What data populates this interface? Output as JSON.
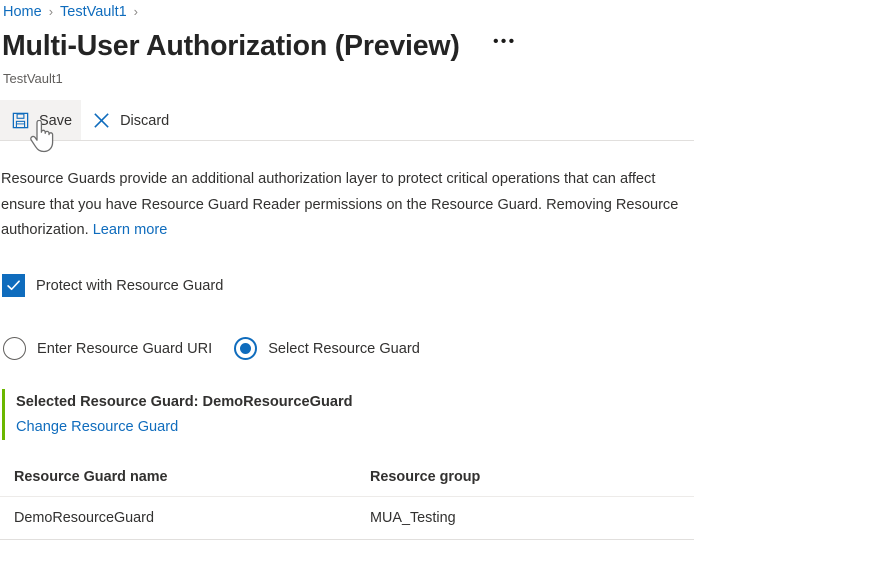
{
  "breadcrumb": {
    "items": [
      {
        "label": "Home"
      },
      {
        "label": "TestVault1"
      }
    ],
    "separator": "›"
  },
  "header": {
    "title": "Multi-User Authorization (Preview)",
    "subtitle": "TestVault1",
    "more_menu_label": "•••"
  },
  "toolbar": {
    "save_label": "Save",
    "save_icon": "save-floppy-icon",
    "discard_label": "Discard",
    "discard_icon": "close-x-icon",
    "hovered_button": "save"
  },
  "description": {
    "line1": "Resource Guards provide an additional authorization layer to protect critical operations that can affect",
    "line2": "ensure that you have Resource Guard Reader permissions on the Resource Guard. Removing Resource",
    "line3_prefix": "authorization.",
    "learn_more_label": "Learn more"
  },
  "protect_checkbox": {
    "label": "Protect with Resource Guard",
    "checked": true
  },
  "mode_radios": {
    "options": [
      {
        "label": "Enter Resource Guard URI",
        "selected": false
      },
      {
        "label": "Select Resource Guard",
        "selected": true
      }
    ]
  },
  "selected_guard": {
    "summary": "Selected Resource Guard: DemoResourceGuard",
    "change_link_label": "Change Resource Guard",
    "accent_color": "#6bb700"
  },
  "guard_table": {
    "columns": [
      "Resource Guard name",
      "Resource group"
    ],
    "rows": [
      [
        "DemoResourceGuard",
        "MUA_Testing"
      ]
    ]
  },
  "colors": {
    "link": "#0f6cbd",
    "accent_blue": "#0f6cbd",
    "text": "#323130",
    "subtle_text": "#605e5c",
    "green_accent": "#6bb700",
    "hover_bg": "#f3f2f1"
  }
}
